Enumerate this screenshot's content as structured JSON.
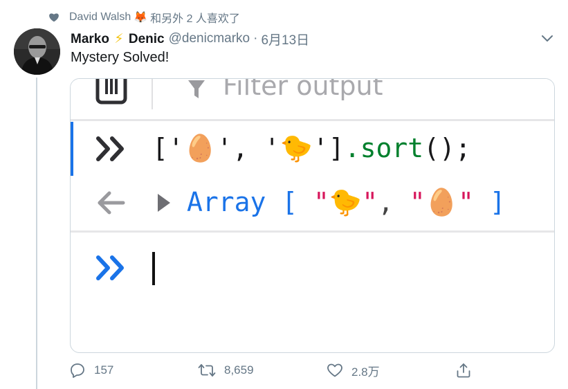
{
  "social_context": {
    "user": "David Walsh",
    "emoji": "🦊",
    "suffix": "和另外 2 人喜欢了"
  },
  "tweet": {
    "display_name_first": "Marko",
    "display_name_emoji": "⚡",
    "display_name_last": "Denic",
    "handle": "@denicmarko",
    "separator": "·",
    "date": "6月13日",
    "text": "Mystery Solved!"
  },
  "console": {
    "filter_placeholder": "Filter output",
    "input": {
      "open": "['",
      "egg": "🥚",
      "mid": "', '",
      "chick": "🐤",
      "close": "']",
      "method": ".sort",
      "end": "();"
    },
    "output": {
      "type": "Array",
      "open": " [ ",
      "q1": "\"",
      "chick": "🐤",
      "q2": "\"",
      "comma": ", ",
      "q3": "\"",
      "egg": "🥚",
      "q4": "\"",
      "close": " ]"
    }
  },
  "actions": {
    "replies": "157",
    "retweets": "8,659",
    "likes": "2.8万"
  },
  "colors": {
    "accent": "#1a73e8",
    "muted": "#657786",
    "string_green": "#00703a",
    "string_pink": "#d7175c"
  },
  "icons": [
    "heart-icon",
    "avatar",
    "chevron-down-icon",
    "trash-icon",
    "filter-icon",
    "prompt-icon",
    "return-arrow-icon",
    "expand-triangle-icon",
    "reply-icon",
    "retweet-icon",
    "like-icon",
    "share-icon"
  ]
}
